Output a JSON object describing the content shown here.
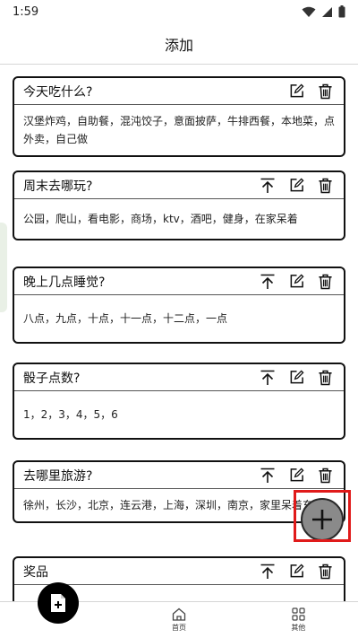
{
  "status": {
    "time": "1:59"
  },
  "header": {
    "title": "添加"
  },
  "cards": [
    {
      "title": "今天吃什么?",
      "content": "汉堡炸鸡，自助餐，混沌饺子，意面披萨，牛排西餐，本地菜，点外卖，自己做",
      "pin": false
    },
    {
      "title": "周末去哪玩?",
      "content": "公园，爬山，看电影，商场，ktv，酒吧，健身，在家呆着",
      "pin": true
    },
    {
      "title": "晚上几点睡觉?",
      "content": "八点，九点，十点，十一点，十二点，一点",
      "pin": true
    },
    {
      "title": "骰子点数?",
      "content": "1，2，3，4，5，6",
      "pin": true
    },
    {
      "title": "去哪里旅游?",
      "content": "徐州，长沙，北京，连云港，上海，深圳，南京，家里呆着东",
      "pin": true
    },
    {
      "title": "奖品",
      "content": "",
      "pin": true
    }
  ],
  "nav": {
    "home_label": "首页",
    "other_label": "其他"
  },
  "icons": {
    "pin": "pin-top-icon",
    "edit": "edit-icon",
    "delete": "trash-icon",
    "add": "plus-icon",
    "new_doc": "add-document-icon",
    "home": "home-icon",
    "other": "grid-icon"
  }
}
